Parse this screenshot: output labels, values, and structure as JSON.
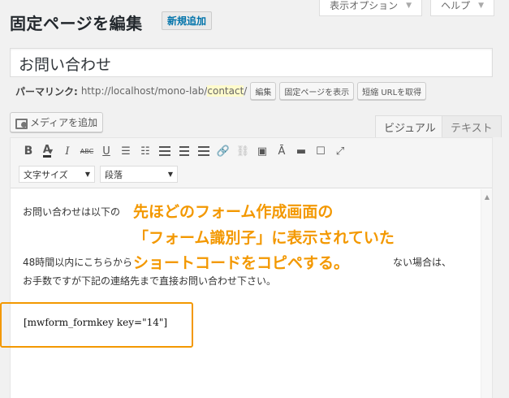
{
  "screen_tabs": {
    "options": "表示オプション",
    "help": "ヘルプ"
  },
  "page": {
    "title": "固定ページを編集",
    "add_new": "新規追加",
    "post_title": "お問い合わせ"
  },
  "permalink": {
    "label": "パーマリンク:",
    "base_url": "http://localhost/mono-lab/",
    "slug": "contact",
    "trailing": "/",
    "edit": "編集",
    "view": "固定ページを表示",
    "shortlink": "短縮 URLを取得"
  },
  "media": {
    "add_media": "メディアを追加"
  },
  "editor_tabs": {
    "visual": "ビジュアル",
    "text": "テキスト"
  },
  "toolbar": {
    "font_size": "文字サイズ",
    "format": "段落"
  },
  "content": {
    "line1": "お問い合わせは以下の",
    "line2a": "48時間以内にこちらから",
    "line2b": "ない場合は、",
    "line3": "お手数ですが下記の連絡先まで直接お問い合わせ下さい。",
    "shortcode": "[mwform_formkey key=\"14\"]"
  },
  "annotation": {
    "line1": "先ほどのフォーム作成画面の",
    "line2": "「フォーム識別子」に表示されていた",
    "line3": "ショートコードをコピペする。",
    "color": "#f39800"
  }
}
